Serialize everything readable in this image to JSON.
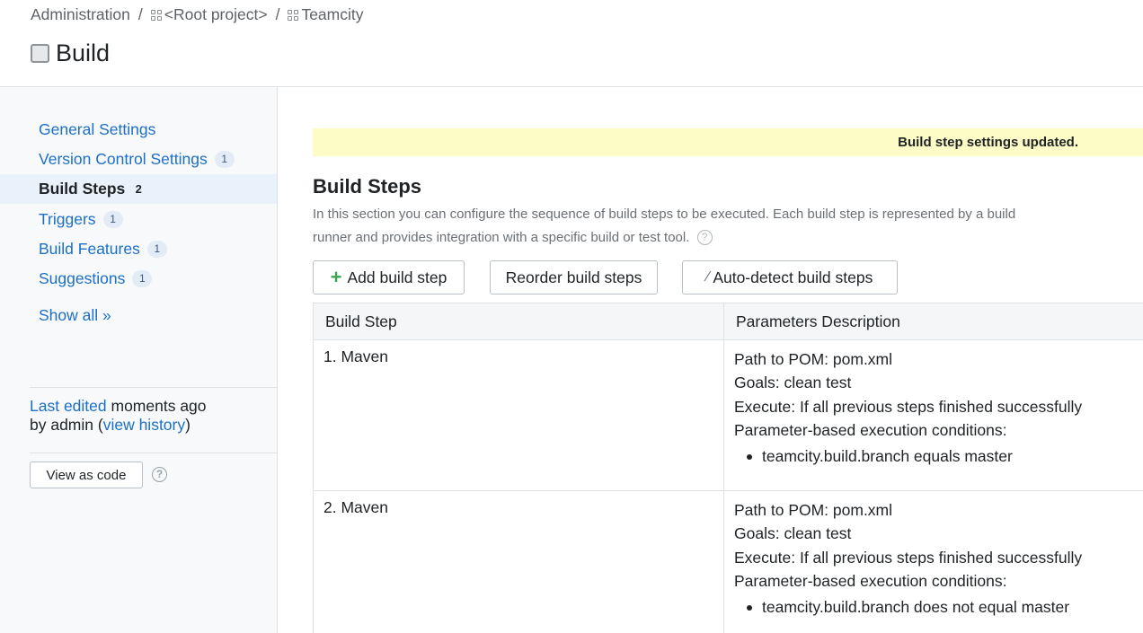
{
  "breadcrumb": {
    "items": [
      "Administration",
      "<Root project>",
      "Teamcity"
    ],
    "separator": "/"
  },
  "page": {
    "title": "Build"
  },
  "sidebar": {
    "items": [
      {
        "label": "General Settings",
        "count": ""
      },
      {
        "label": "Version Control Settings",
        "count": "1"
      },
      {
        "label": "Build Steps",
        "count": "2",
        "active": true
      },
      {
        "label": "Triggers",
        "count": "1"
      },
      {
        "label": "Build Features",
        "count": "1"
      },
      {
        "label": "Suggestions",
        "count": "1"
      }
    ],
    "show_all": "Show all »",
    "last_edited": {
      "link": "Last edited",
      "when": " moments ago",
      "by": "by admin  (",
      "history_link": "view history",
      "close": ")"
    },
    "view_as_code": "View as code",
    "help": "?"
  },
  "notice": "Build step settings updated.",
  "main": {
    "title": "Build Steps",
    "description": "In this section you can configure the sequence of build steps to be executed. Each build step is represented by a build runner and provides integration with a specific build or test tool.",
    "help": "?",
    "buttons": {
      "add": "Add build step",
      "reorder": "Reorder build steps",
      "autodetect": "Auto-detect build steps"
    },
    "table": {
      "headers": [
        "Build Step",
        "Parameters Description"
      ],
      "rows": [
        {
          "step": "1. Maven",
          "params": [
            "Path to POM: pom.xml",
            "Goals: clean test",
            "Execute: If all previous steps finished successfully",
            "Parameter-based execution conditions:"
          ],
          "conditions": [
            "teamcity.build.branch equals master"
          ]
        },
        {
          "step": "2. Maven",
          "params": [
            "Path to POM: pom.xml",
            "Goals: clean test",
            "Execute: If all previous steps finished successfully",
            "Parameter-based execution conditions:"
          ],
          "conditions": [
            "teamcity.build.branch does not equal master"
          ]
        }
      ]
    }
  },
  "colors": {
    "link": "#1c6fc6",
    "notice_bg": "#fdfbc6",
    "sidebar_bg": "#f7f9fa",
    "active_bg": "#e9f1fa",
    "add_icon": "#3aa655"
  }
}
